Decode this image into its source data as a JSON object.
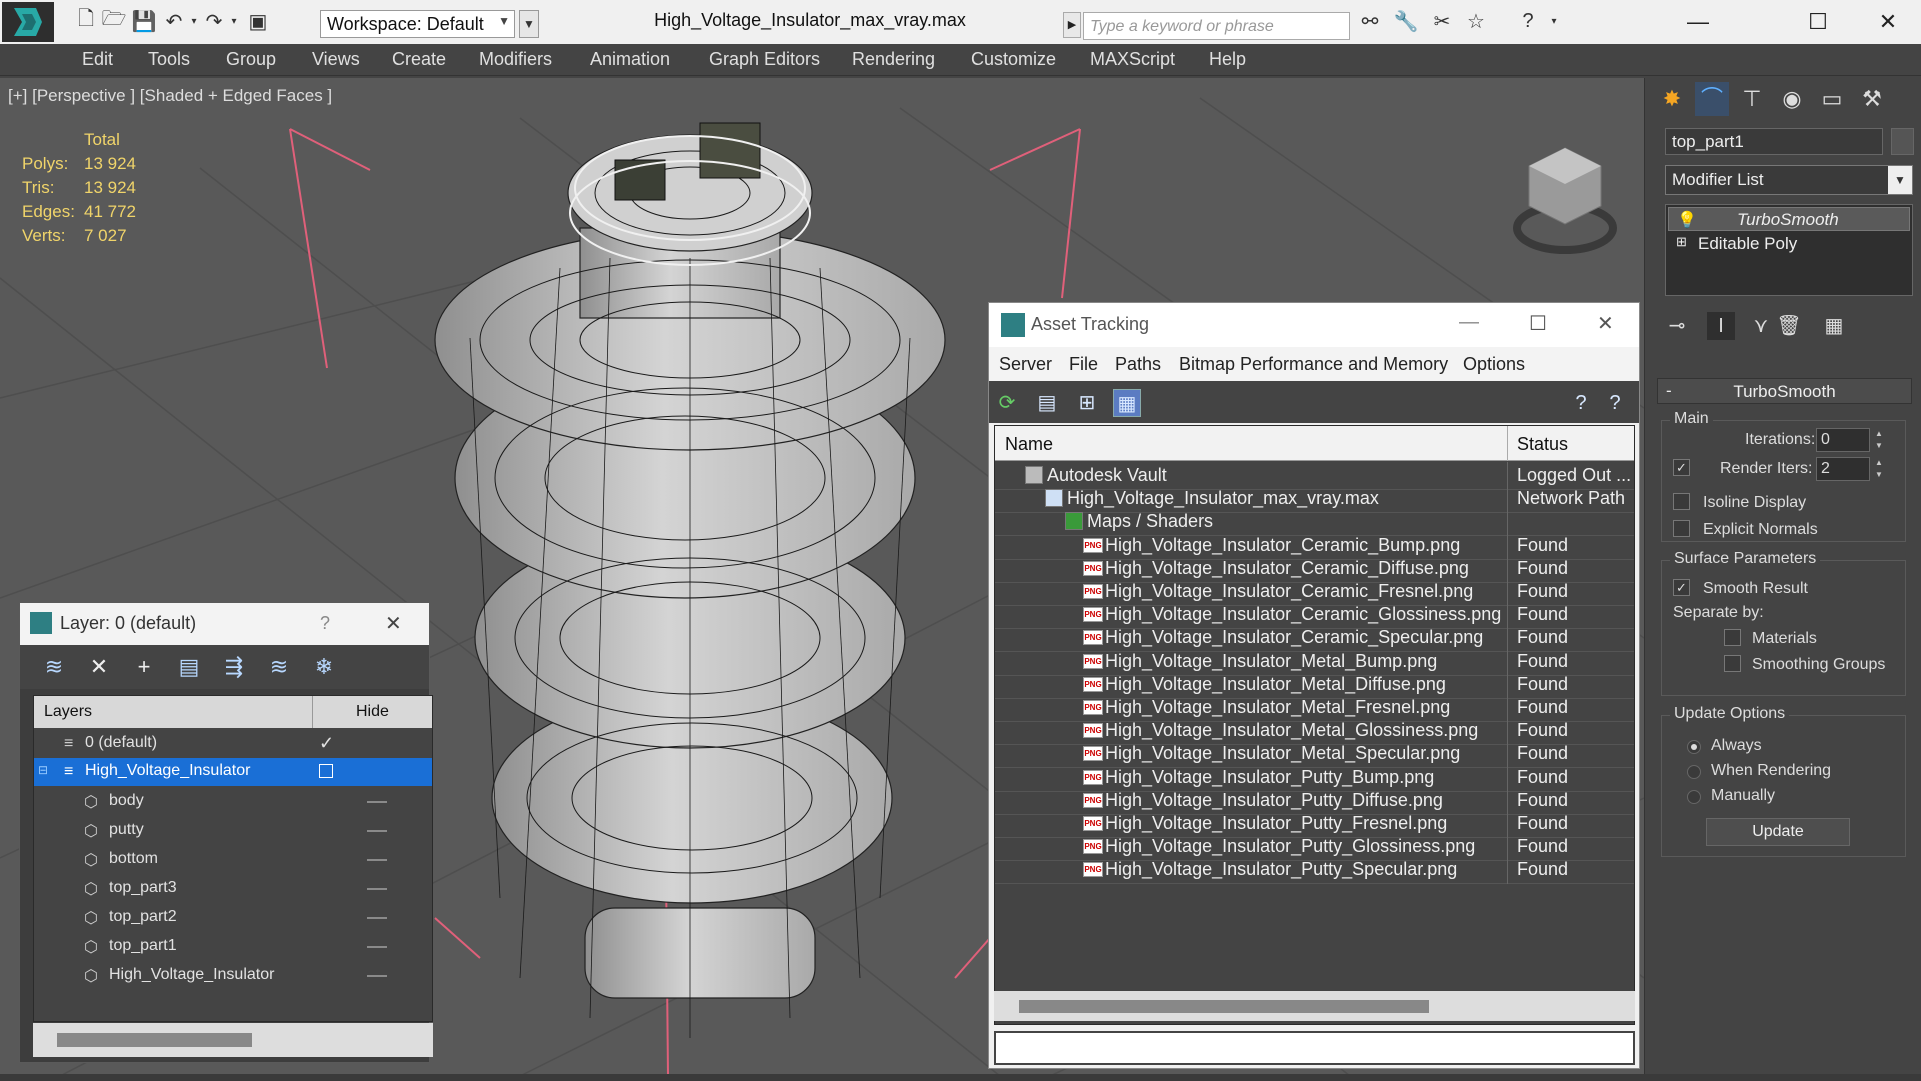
{
  "titlebar": {
    "workspace_label": "Workspace: Default",
    "doc_title": "High_Voltage_Insulator_max_vray.max",
    "search_placeholder": "Type a keyword or phrase",
    "minimize": "—",
    "maximize": "☐",
    "close": "✕",
    "icons": [
      "app-logo-icon",
      "new-icon",
      "open-icon",
      "save-icon",
      "undo-icon",
      "redo-icon",
      "project-icon",
      "binoculars-icon",
      "key-icon",
      "star-icon",
      "help-icon"
    ]
  },
  "menu": [
    "Edit",
    "Tools",
    "Group",
    "Views",
    "Create",
    "Modifiers",
    "Animation",
    "Graph Editors",
    "Rendering",
    "Customize",
    "MAXScript",
    "Help"
  ],
  "viewport": {
    "label": "[+] [Perspective ] [Shaded + Edged Faces ]",
    "stats": {
      "header": "Total",
      "rows": [
        {
          "k": "Polys:",
          "v": "13 924"
        },
        {
          "k": "Tris:",
          "v": "13 924"
        },
        {
          "k": "Edges:",
          "v": "41 772"
        },
        {
          "k": "Verts:",
          "v": "7 027"
        }
      ]
    }
  },
  "layer_panel": {
    "title": "Layer: 0 (default)",
    "help": "?",
    "close": "✕",
    "col_layers": "Layers",
    "col_hide": "Hide",
    "rows": [
      {
        "name": "0 (default)",
        "indent": 0
      },
      {
        "name": "High_Voltage_Insulator",
        "indent": 0,
        "selected": true
      },
      {
        "name": "body",
        "indent": 1
      },
      {
        "name": "putty",
        "indent": 1
      },
      {
        "name": "bottom",
        "indent": 1
      },
      {
        "name": "top_part3",
        "indent": 1
      },
      {
        "name": "top_part2",
        "indent": 1
      },
      {
        "name": "top_part1",
        "indent": 1
      },
      {
        "name": "High_Voltage_Insulator",
        "indent": 1
      }
    ]
  },
  "asset_tracking": {
    "title": "Asset Tracking",
    "minimize": "—",
    "maximize": "☐",
    "close": "✕",
    "menu": [
      "Server",
      "File",
      "Paths",
      "Bitmap Performance and Memory",
      "Options"
    ],
    "col_name": "Name",
    "col_status": "Status",
    "rows": [
      {
        "name": "Autodesk Vault",
        "status": "Logged Out ...",
        "level": 0,
        "icon": "vault-icon"
      },
      {
        "name": "High_Voltage_Insulator_max_vray.max",
        "status": "Network Path",
        "level": 1,
        "icon": "max-file-icon"
      },
      {
        "name": "Maps / Shaders",
        "status": "",
        "level": 2,
        "icon": "maps-icon"
      },
      {
        "name": "High_Voltage_Insulator_Ceramic_Bump.png",
        "status": "Found",
        "level": 3,
        "icon": "png-icon"
      },
      {
        "name": "High_Voltage_Insulator_Ceramic_Diffuse.png",
        "status": "Found",
        "level": 3,
        "icon": "png-icon"
      },
      {
        "name": "High_Voltage_Insulator_Ceramic_Fresnel.png",
        "status": "Found",
        "level": 3,
        "icon": "png-icon"
      },
      {
        "name": "High_Voltage_Insulator_Ceramic_Glossiness.png",
        "status": "Found",
        "level": 3,
        "icon": "png-icon"
      },
      {
        "name": "High_Voltage_Insulator_Ceramic_Specular.png",
        "status": "Found",
        "level": 3,
        "icon": "png-icon"
      },
      {
        "name": "High_Voltage_Insulator_Metal_Bump.png",
        "status": "Found",
        "level": 3,
        "icon": "png-icon"
      },
      {
        "name": "High_Voltage_Insulator_Metal_Diffuse.png",
        "status": "Found",
        "level": 3,
        "icon": "png-icon"
      },
      {
        "name": "High_Voltage_Insulator_Metal_Fresnel.png",
        "status": "Found",
        "level": 3,
        "icon": "png-icon"
      },
      {
        "name": "High_Voltage_Insulator_Metal_Glossiness.png",
        "status": "Found",
        "level": 3,
        "icon": "png-icon"
      },
      {
        "name": "High_Voltage_Insulator_Metal_Specular.png",
        "status": "Found",
        "level": 3,
        "icon": "png-icon"
      },
      {
        "name": "High_Voltage_Insulator_Putty_Bump.png",
        "status": "Found",
        "level": 3,
        "icon": "png-icon"
      },
      {
        "name": "High_Voltage_Insulator_Putty_Diffuse.png",
        "status": "Found",
        "level": 3,
        "icon": "png-icon"
      },
      {
        "name": "High_Voltage_Insulator_Putty_Fresnel.png",
        "status": "Found",
        "level": 3,
        "icon": "png-icon"
      },
      {
        "name": "High_Voltage_Insulator_Putty_Glossiness.png",
        "status": "Found",
        "level": 3,
        "icon": "png-icon"
      },
      {
        "name": "High_Voltage_Insulator_Putty_Specular.png",
        "status": "Found",
        "level": 3,
        "icon": "png-icon"
      }
    ]
  },
  "command_panel": {
    "object_name": "top_part1",
    "modifier_list": "Modifier List",
    "stack": [
      "TurboSmooth",
      "Editable Poly"
    ],
    "rollout_title": "TurboSmooth",
    "main_group": "Main",
    "iterations_label": "Iterations:",
    "iterations_value": "0",
    "render_iters_label": "Render Iters:",
    "render_iters_value": "2",
    "render_iters_checked": true,
    "isoline_label": "Isoline Display",
    "explicit_normals_label": "Explicit Normals",
    "surface_group": "Surface Parameters",
    "smooth_result_label": "Smooth Result",
    "smooth_result_checked": true,
    "separate_by_label": "Separate by:",
    "materials_label": "Materials",
    "smoothing_groups_label": "Smoothing Groups",
    "update_group": "Update Options",
    "always_label": "Always",
    "when_rendering_label": "When Rendering",
    "manually_label": "Manually",
    "update_button": "Update"
  },
  "colors": {
    "accent_selection": "#1a6fd6",
    "stats_text": "#f0d46a",
    "gizmo_pink": "#e0607a",
    "viewport_bg": "#595959"
  }
}
